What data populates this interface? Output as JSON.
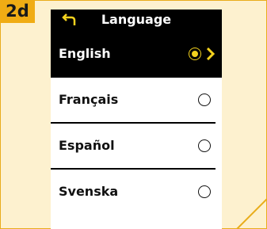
{
  "badge": "2d",
  "header": {
    "title": "Language"
  },
  "languages": [
    {
      "label": "English",
      "selected": true
    },
    {
      "label": "Français",
      "selected": false
    },
    {
      "label": "Español",
      "selected": false
    },
    {
      "label": "Svenska",
      "selected": false
    }
  ],
  "colors": {
    "accent": "#f0ac14",
    "radio_selected": "#f4d21e",
    "background": "#fdf1cf"
  }
}
